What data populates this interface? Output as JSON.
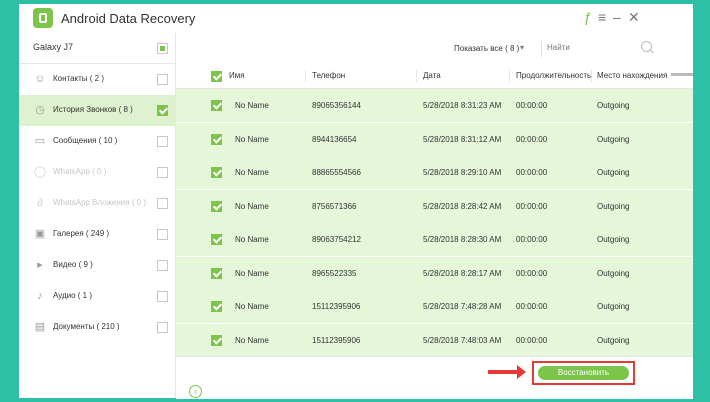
{
  "app": {
    "title": "Android Data Recovery"
  },
  "titlebar": {
    "leaf_icon": "leaf-icon",
    "menu_icon": "menu-icon",
    "minimize_icon": "minimize-icon",
    "close_icon": "close-icon"
  },
  "sidebar": {
    "device": {
      "label": "Galaxy J7"
    },
    "items": [
      {
        "label": "Контакты ( 2 )",
        "icon": "contacts-icon",
        "checked": false,
        "disabled": false,
        "active": false
      },
      {
        "label": "История Звонков ( 8 )",
        "icon": "clock-icon",
        "checked": true,
        "disabled": false,
        "active": true
      },
      {
        "label": "Сообщения ( 10 )",
        "icon": "message-icon",
        "checked": false,
        "disabled": false,
        "active": false
      },
      {
        "label": "WhatsApp ( 0 )",
        "icon": "whatsapp-icon",
        "checked": false,
        "disabled": true,
        "active": false
      },
      {
        "label": "WhatsApp Вложения ( 0 )",
        "icon": "attachment-icon",
        "checked": false,
        "disabled": true,
        "active": false
      },
      {
        "label": "Галерея ( 249 )",
        "icon": "gallery-icon",
        "checked": false,
        "disabled": false,
        "active": false
      },
      {
        "label": "Видео ( 9 )",
        "icon": "video-icon",
        "checked": false,
        "disabled": false,
        "active": false
      },
      {
        "label": "Аудио ( 1 )",
        "icon": "audio-icon",
        "checked": false,
        "disabled": false,
        "active": false
      },
      {
        "label": "Документы ( 210 )",
        "icon": "document-icon",
        "checked": false,
        "disabled": false,
        "active": false
      }
    ]
  },
  "filter": {
    "show_all": "Показать все ( 8 )",
    "search_placeholder": "Найти"
  },
  "table": {
    "headers": {
      "name": "Имя",
      "phone": "Телефон",
      "date": "Дата",
      "duration": "Продолжительность",
      "location": "Место нахождения"
    },
    "rows": [
      {
        "name": "No Name",
        "phone": "89065356144",
        "date": "5/28/2018 8:31:23 AM",
        "duration": "00:00:00",
        "type": "Outgoing"
      },
      {
        "name": "No Name",
        "phone": "8944136654",
        "date": "5/28/2018 8:31:12 AM",
        "duration": "00:00:00",
        "type": "Outgoing"
      },
      {
        "name": "No Name",
        "phone": "88865554566",
        "date": "5/28/2018 8:29:10 AM",
        "duration": "00:00:00",
        "type": "Outgoing"
      },
      {
        "name": "No Name",
        "phone": "8756571366",
        "date": "5/28/2018 8:28:42 AM",
        "duration": "00:00:00",
        "type": "Outgoing"
      },
      {
        "name": "No Name",
        "phone": "89063754212",
        "date": "5/28/2018 8:28:30 AM",
        "duration": "00:00:00",
        "type": "Outgoing"
      },
      {
        "name": "No Name",
        "phone": "8965522335",
        "date": "5/28/2018 8:28:17 AM",
        "duration": "00:00:00",
        "type": "Outgoing"
      },
      {
        "name": "No Name",
        "phone": "15112395906",
        "date": "5/28/2018 7:48:28 AM",
        "duration": "00:00:00",
        "type": "Outgoing"
      },
      {
        "name": "No Name",
        "phone": "15112395906",
        "date": "5/28/2018 7:48:03 AM",
        "duration": "00:00:00",
        "type": "Outgoing"
      }
    ]
  },
  "bottom": {
    "recover_label": "Восстановить"
  },
  "colors": {
    "accent": "#7cc44a",
    "frame": "#2ec0a6",
    "row": "#e6f6d9",
    "highlight": "#e53935"
  }
}
